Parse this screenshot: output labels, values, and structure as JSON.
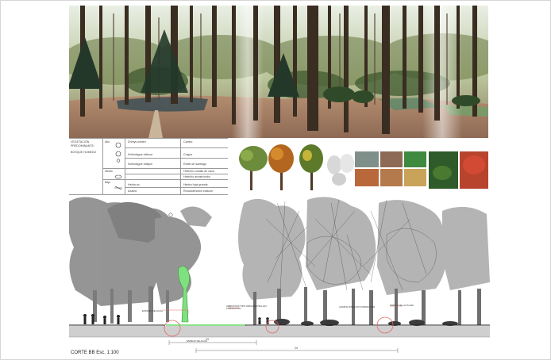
{
  "vegetation_table": {
    "header": [
      "VEGETACIÓN",
      "PREDOMINANTE:",
      "BOSQUE HUMEDO"
    ],
    "strata": [
      {
        "name": "Alto",
        "species": [
          {
            "scientific": "Drimys winteri",
            "common": "Canelo"
          },
          {
            "scientific": "Nothofague oblicua",
            "common": "Coigue"
          },
          {
            "scientific": "Nothofague oblique",
            "common": "Roble de santiago"
          }
        ]
      },
      {
        "name": "Medio",
        "species": [
          {
            "scientific": "",
            "common": "Helecho costilla de vaca"
          },
          {
            "scientific": "",
            "common": "Helecho arrastrondro"
          }
        ]
      },
      {
        "name": "Bajo",
        "species": [
          {
            "scientific": "Hedra sp.",
            "common": "Hiedra hoja grande"
          },
          {
            "scientific": "Azalea",
            "common": "Rhododendron indicum"
          }
        ]
      }
    ]
  },
  "section": {
    "title": "CORTE BB Esc. 1:100",
    "annotations": [
      "ESPEJO DE AGUA",
      "ARBUSTOS TIPO ORNAMENTAL EN FORMACION",
      "CAMINO ESPACIO FORMACION",
      "ORILLA DE LA PLAZA",
      "ESPEJO DE AGUA"
    ],
    "dims": [
      "24",
      "24"
    ]
  },
  "colors": {
    "tree_gray": "#8f8f8f",
    "tree_light": "#b4b4b4",
    "water_green": "#7fe07f",
    "accent_red": "#e06a6a",
    "blueprint_dim": "#4a4a4a"
  },
  "icons": [
    "tree-symbol-icon",
    "shrub-symbol-icon",
    "human-figure-icon"
  ]
}
